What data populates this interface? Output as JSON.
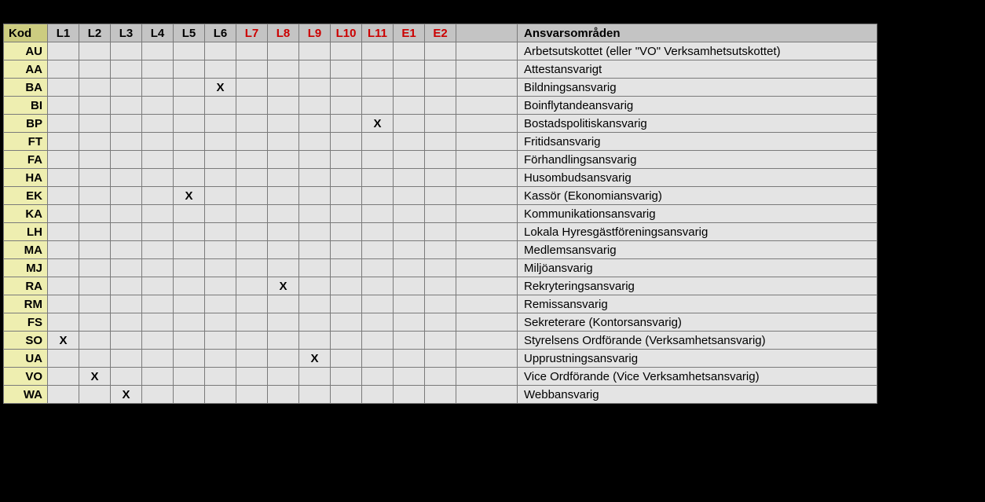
{
  "headers": {
    "kod": "Kod",
    "L1": "L1",
    "L2": "L2",
    "L3": "L3",
    "L4": "L4",
    "L5": "L5",
    "L6": "L6",
    "L7": "L7",
    "L8": "L8",
    "L9": "L9",
    "L10": "L10",
    "L11": "L11",
    "E1": "E1",
    "E2": "E2",
    "ansvar": "Ansvarsområden"
  },
  "redCols": [
    "L7",
    "L8",
    "L9",
    "L10",
    "L11",
    "E1",
    "E2"
  ],
  "cols": [
    "L1",
    "L2",
    "L3",
    "L4",
    "L5",
    "L6",
    "L7",
    "L8",
    "L9",
    "L10",
    "L11",
    "E1",
    "E2"
  ],
  "rows": [
    {
      "kod": "AU",
      "marks": [],
      "desc": "Arbetsutskottet (eller \"VO\" Verksamhetsutskottet)"
    },
    {
      "kod": "AA",
      "marks": [],
      "desc": "Attestansvarigt"
    },
    {
      "kod": "BA",
      "marks": [
        "L6"
      ],
      "desc": "Bildningsansvarig"
    },
    {
      "kod": "BI",
      "marks": [],
      "desc": "Boinflytandeansvarig"
    },
    {
      "kod": "BP",
      "marks": [
        "L11"
      ],
      "desc": "Bostadspolitiskansvarig"
    },
    {
      "kod": "FT",
      "marks": [],
      "desc": "Fritidsansvarig"
    },
    {
      "kod": "FA",
      "marks": [],
      "desc": "Förhandlingsansvarig"
    },
    {
      "kod": "HA",
      "marks": [],
      "desc": "Husombudsansvarig"
    },
    {
      "kod": "EK",
      "marks": [
        "L5"
      ],
      "desc": "Kassör (Ekonomiansvarig)"
    },
    {
      "kod": "KA",
      "marks": [],
      "desc": "Kommunikationsansvarig"
    },
    {
      "kod": "LH",
      "marks": [],
      "desc": "Lokala Hyresgästföreningsansvarig"
    },
    {
      "kod": "MA",
      "marks": [],
      "desc": "Medlemsansvarig"
    },
    {
      "kod": "MJ",
      "marks": [],
      "desc": "Miljöansvarig"
    },
    {
      "kod": "RA",
      "marks": [
        "L8"
      ],
      "desc": "Rekryteringsansvarig"
    },
    {
      "kod": "RM",
      "marks": [],
      "desc": "Remissansvarig"
    },
    {
      "kod": "FS",
      "marks": [],
      "desc": "Sekreterare (Kontorsansvarig)"
    },
    {
      "kod": "SO",
      "marks": [
        "L1"
      ],
      "desc": "Styrelsens Ordförande (Verksamhetsansvarig)"
    },
    {
      "kod": "UA",
      "marks": [
        "L9"
      ],
      "desc": "Upprustningsansvarig"
    },
    {
      "kod": "VO",
      "marks": [
        "L2"
      ],
      "desc": "Vice Ordförande (Vice Verksamhetsansvarig)"
    },
    {
      "kod": "WA",
      "marks": [
        "L3"
      ],
      "desc": "Webbansvarig"
    }
  ],
  "mark": "X"
}
